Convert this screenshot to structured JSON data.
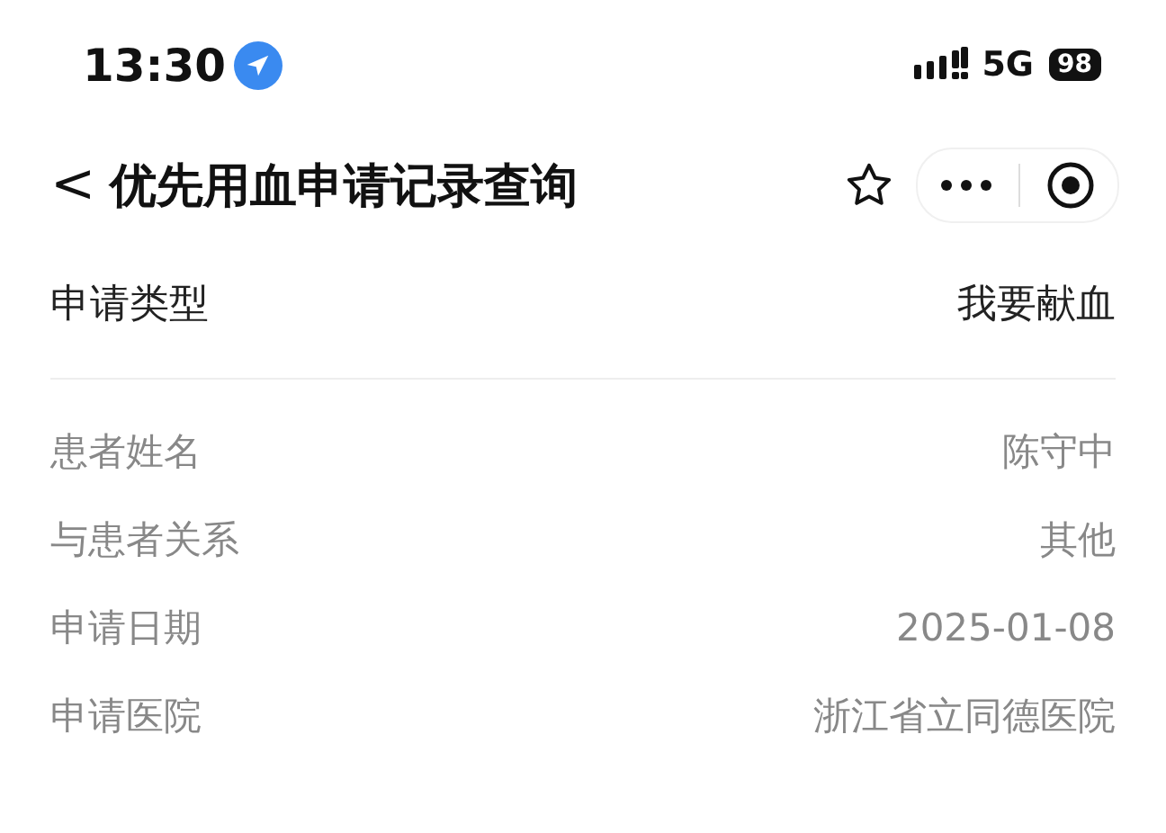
{
  "status_bar": {
    "time": "13:30",
    "network": "5G",
    "battery": "98"
  },
  "nav": {
    "back": "<",
    "title": "优先用血申请记录查询"
  },
  "section": {
    "label": "申请类型",
    "value": "我要献血"
  },
  "rows": [
    {
      "label": "患者姓名",
      "value": "陈守中"
    },
    {
      "label": "与患者关系",
      "value": "其他"
    },
    {
      "label": "申请日期",
      "value": "2025-01-08"
    },
    {
      "label": "申请医院",
      "value": "浙江省立同德医院"
    }
  ]
}
